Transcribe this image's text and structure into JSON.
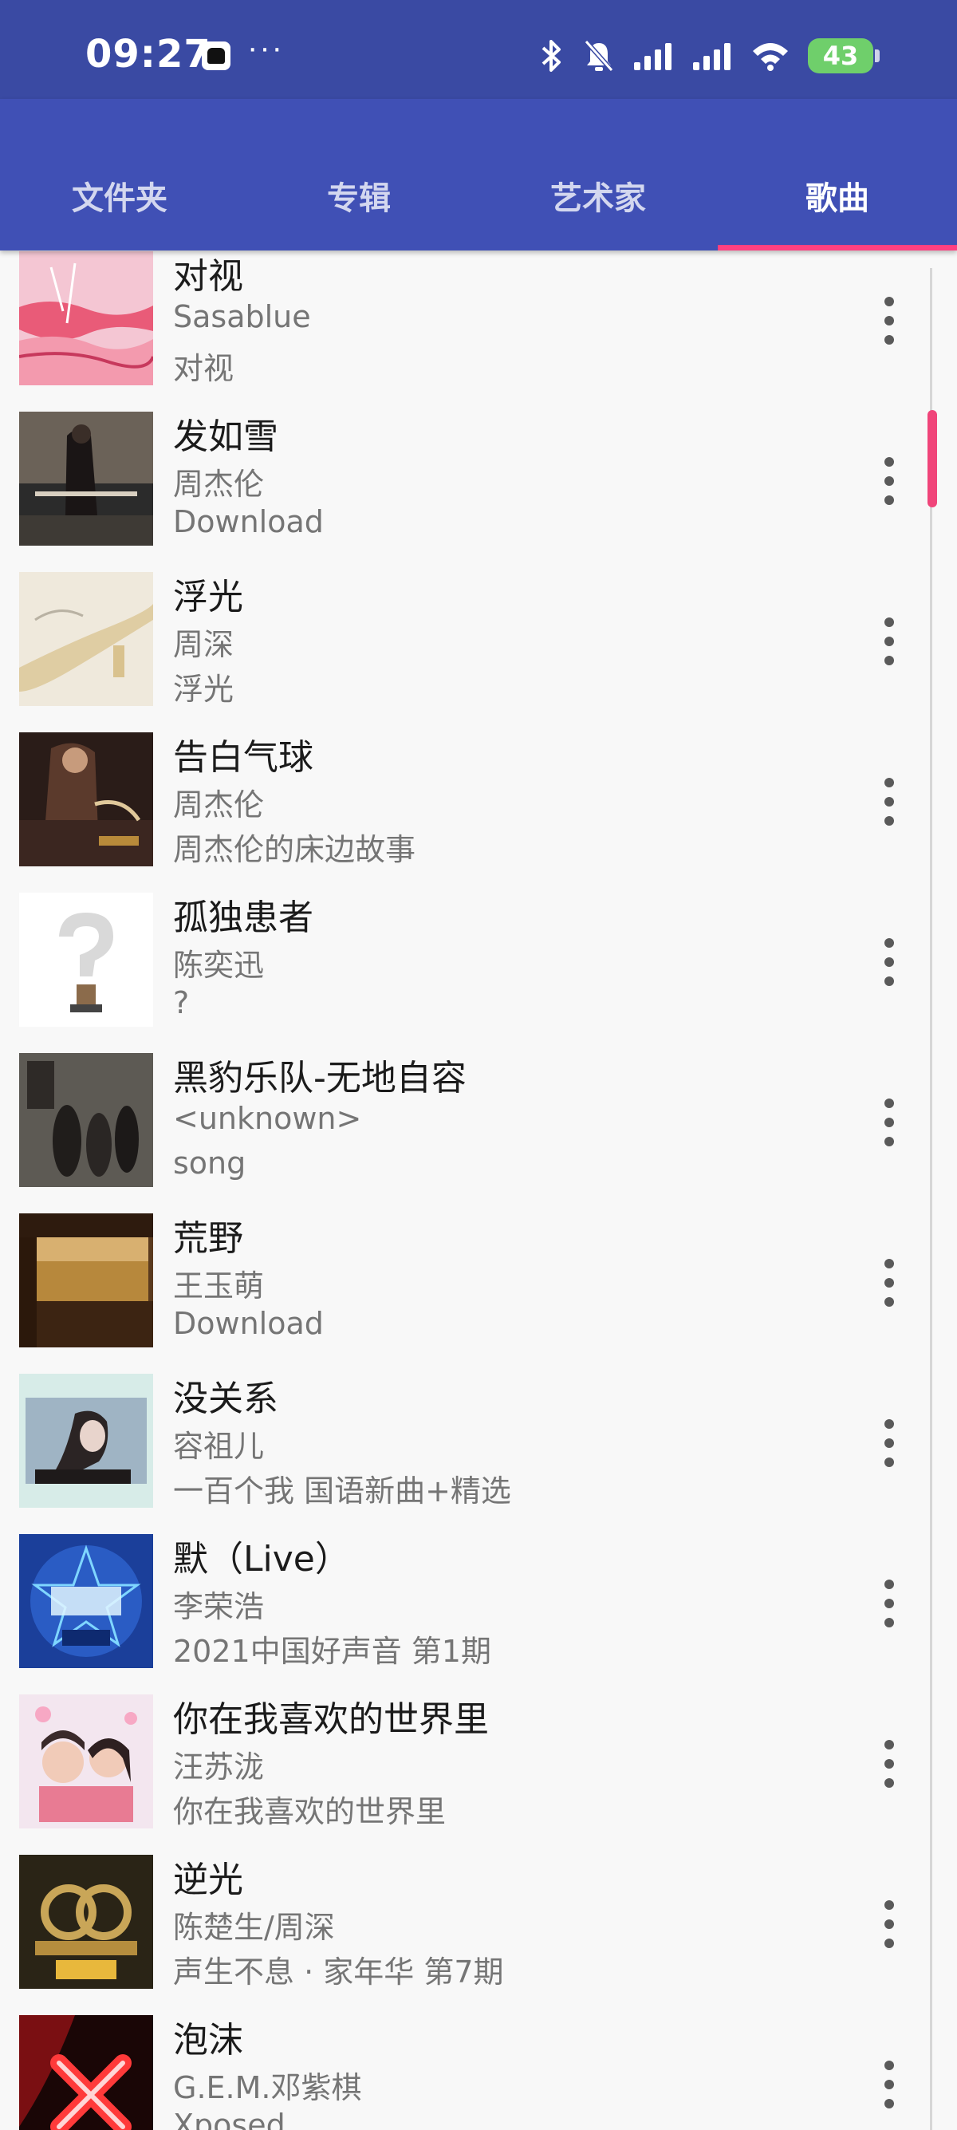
{
  "status_bar": {
    "time": "09:27",
    "app_icon": "notification-app-icon",
    "more": "···",
    "battery": "43"
  },
  "colors": {
    "header": "#4050b5",
    "status": "#3a4aa3",
    "accent": "#ff4081"
  },
  "tabs": [
    {
      "label": "文件夹",
      "active": false
    },
    {
      "label": "专辑",
      "active": false
    },
    {
      "label": "艺术家",
      "active": false
    },
    {
      "label": "歌曲",
      "active": true
    }
  ],
  "songs": [
    {
      "title": "对视",
      "artist": "Sasablue",
      "album": "对视"
    },
    {
      "title": "发如雪",
      "artist": "周杰伦",
      "album": "Download"
    },
    {
      "title": "浮光",
      "artist": "周深",
      "album": "浮光"
    },
    {
      "title": "告白气球",
      "artist": "周杰伦",
      "album": "周杰伦的床边故事"
    },
    {
      "title": "孤独患者",
      "artist": "陈奕迅",
      "album": "?"
    },
    {
      "title": "黑豹乐队-无地自容",
      "artist": "<unknown>",
      "album": "song"
    },
    {
      "title": "荒野",
      "artist": "王玉萌",
      "album": "Download"
    },
    {
      "title": "没关系",
      "artist": "容祖儿",
      "album": "一百个我 国语新曲+精选"
    },
    {
      "title": "默（Live）",
      "artist": "李荣浩",
      "album": "2021中国好声音 第1期"
    },
    {
      "title": "你在我喜欢的世界里",
      "artist": "汪苏泷",
      "album": "你在我喜欢的世界里"
    },
    {
      "title": "逆光",
      "artist": "陈楚生/周深",
      "album": "声生不息 · 家年华 第7期"
    },
    {
      "title": "泡沫",
      "artist": "G.E.M.邓紫棋",
      "album": "Xposed"
    }
  ]
}
